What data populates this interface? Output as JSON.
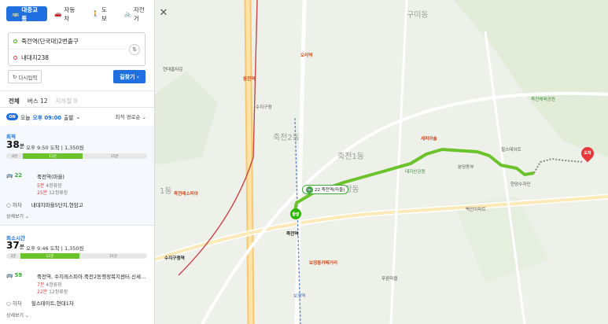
{
  "modes": [
    {
      "label": "대중교통",
      "icon": "bus-icon",
      "active": true
    },
    {
      "label": "자동차",
      "icon": "car-icon"
    },
    {
      "label": "도보",
      "icon": "walk-icon"
    },
    {
      "label": "자전거",
      "icon": "bike-icon"
    }
  ],
  "origin": "죽전역(단국대)2번출구",
  "destination": "내대지238",
  "reinput_label": "다시입력",
  "search_label": "길찾기",
  "subtabs": [
    {
      "label": "전체",
      "active": true
    },
    {
      "label": "버스 12"
    },
    {
      "label": "지하철 0",
      "disabled": true
    }
  ],
  "depart": {
    "toggle": "ON",
    "prefix": "오늘",
    "time": "오후 09:00",
    "suffix": "출발"
  },
  "sort_label": "최적 경로순",
  "routes": [
    {
      "tag": "최적",
      "minutes": "38",
      "unit": "분",
      "arrival": "오후 9:50 도착",
      "fare": "1,350원",
      "segments": [
        {
          "label": "6분",
          "type": "walk",
          "start": 0,
          "width": 0.12
        },
        {
          "label": "15분",
          "type": "bus",
          "start": 0.12,
          "width": 0.42
        },
        {
          "label": "15분",
          "type": "walk",
          "start": 0.54,
          "width": 0.46
        }
      ],
      "bus_no": "22",
      "board_stop": "죽전역(마을)",
      "arrive1": "5분",
      "arrive1_stops": "4정류장",
      "arrive2": "25분",
      "arrive2_stops": "12정류장",
      "alight_label": "하차",
      "alight_stop": "내대지마을5단지,현암고",
      "more": "상세보기"
    },
    {
      "tag": "최소시간",
      "minutes": "37",
      "unit": "분",
      "arrival": "오후 9:46 도착",
      "fare": "1,350원",
      "segments": [
        {
          "label": "3분",
          "type": "walk",
          "start": 0,
          "width": 0.1
        },
        {
          "label": "12분",
          "type": "bus",
          "start": 0.1,
          "width": 0.42
        },
        {
          "label": "21분",
          "type": "walk",
          "start": 0.52,
          "width": 0.48
        }
      ],
      "bus_no": "59",
      "board_stop": "죽전역, 수지레스피아.죽전2동행정복지센터.신세...",
      "arrive1": "7분",
      "arrive1_stops": "4정류장",
      "arrive2": "22분",
      "arrive2_stops": "12정류장",
      "alight_label": "하차",
      "alight_stop": "힐스테이트,현대1차",
      "more": "상세보기"
    }
  ],
  "map": {
    "dongs": [
      "구미동",
      "죽전2동",
      "죽전1동",
      "보정동",
      "1동"
    ],
    "stations": [
      "오리역",
      "동천역",
      "죽전역",
      "보정역",
      "수지구청역"
    ],
    "places": [
      "죽전체육공원",
      "대지산공원",
      "세피아솔",
      "보정동카페거리",
      "힐스테이트",
      "벽산아파트",
      "한양수자인",
      "분당동부",
      "푸른마을",
      "현대홈타운",
      "수지구청",
      "죽전레스피아"
    ],
    "bus_flag": "22 죽전역(마을)",
    "start_label": "출발",
    "end_label": "도착"
  },
  "colors": {
    "accent": "#1f6fe0",
    "bus": "#3aaa35",
    "route": "#6cc22a",
    "dest": "#e6393b"
  }
}
